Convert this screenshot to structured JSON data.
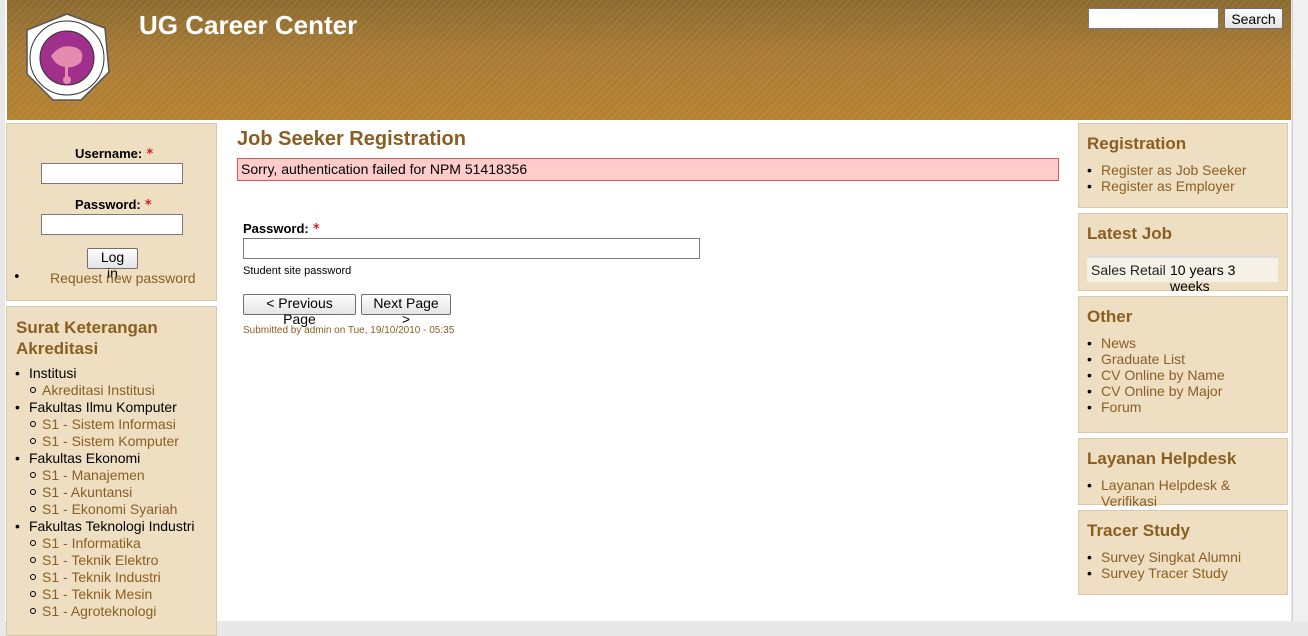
{
  "header": {
    "site_name": "UG Career Center",
    "logo_alt": "Universitas Gunadarma logo",
    "search_placeholder": "",
    "search_button": "Search"
  },
  "login": {
    "username_label": "Username:",
    "password_label": "Password:",
    "required_mark": "*",
    "login_button": "Log in",
    "request_password": "Request new password"
  },
  "akreditasi": {
    "title": "Surat Keterangan Akreditasi",
    "groups": [
      {
        "name": "Institusi",
        "items": [
          "Akreditasi Institusi"
        ]
      },
      {
        "name": "Fakultas Ilmu Komputer",
        "items": [
          "S1 - Sistem Informasi",
          "S1 - Sistem Komputer"
        ]
      },
      {
        "name": "Fakultas Ekonomi",
        "items": [
          "S1 - Manajemen",
          "S1 - Akuntansi",
          "S1 - Ekonomi Syariah"
        ]
      },
      {
        "name": "Fakultas Teknologi Industri",
        "items": [
          "S1 - Informatika",
          "S1 - Teknik Elektro",
          "S1 - Teknik Industri",
          "S1 - Teknik Mesin",
          "S1 - Agroteknologi"
        ]
      }
    ]
  },
  "main": {
    "title": "Job Seeker Registration",
    "error_message": "Sorry, authentication failed for NPM 51418356",
    "password_label": "Password:",
    "required_mark": "*",
    "password_description": "Student site password",
    "prev_button": "< Previous Page",
    "next_button": "Next Page >",
    "submitted": "Submitted by admin on Tue, 19/10/2010 - 05:35"
  },
  "right": {
    "registration": {
      "title": "Registration",
      "links": [
        "Register as Job Seeker",
        "Register as Employer"
      ]
    },
    "latest_job": {
      "title": "Latest Job",
      "job_title": "Sales Retail",
      "age": "10 years 3 weeks"
    },
    "other": {
      "title": "Other",
      "links": [
        "News",
        "Graduate List",
        "CV Online by Name",
        "CV Online by Major",
        "Forum"
      ]
    },
    "helpdesk": {
      "title": "Layanan Helpdesk",
      "links": [
        "Layanan Helpdesk & Verifikasi"
      ]
    },
    "tracer": {
      "title": "Tracer Study",
      "links": [
        "Survey Singkat Alumni",
        "Survey Tracer Study"
      ]
    }
  },
  "colors": {
    "header": "#b5812f",
    "block_bg": "#efdfc2",
    "link": "#8a5e22",
    "error_bg": "#ffcccc",
    "error_border": "#dd5555"
  }
}
